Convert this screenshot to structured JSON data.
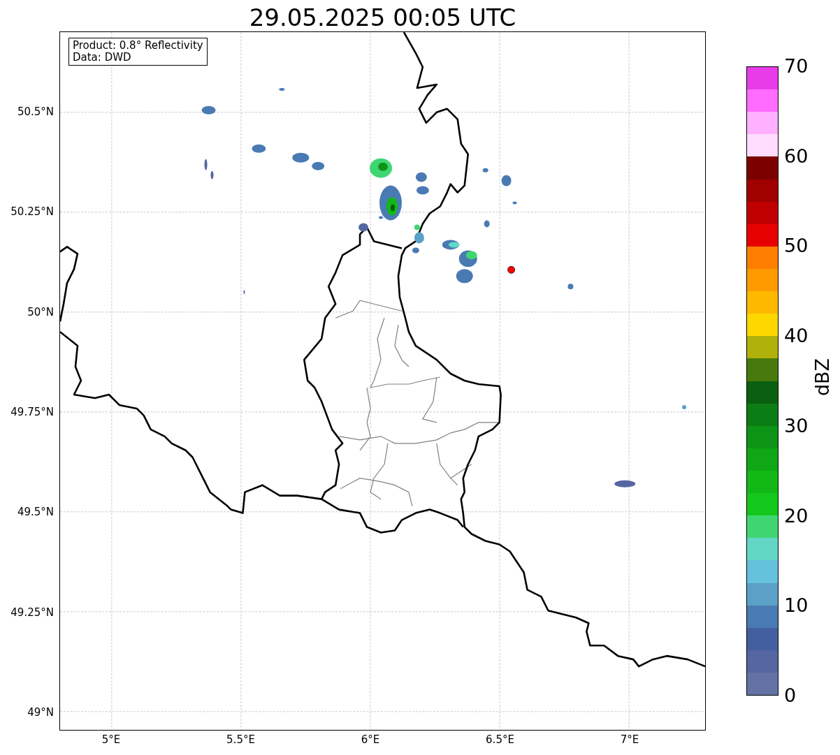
{
  "title": "29.05.2025 00:05 UTC",
  "legend": [
    "Product: 0.8° Reflectivity",
    "Data: DWD"
  ],
  "y_ticks": [
    "50.5°N",
    "50.25°N",
    "50°N",
    "49.75°N",
    "49.5°N",
    "49.25°N",
    "49°N"
  ],
  "x_ticks": [
    "5°E",
    "5.5°E",
    "6°E",
    "6.5°E",
    "7°E"
  ],
  "colorbar": {
    "label": "dBZ",
    "ticks": [
      "70",
      "60",
      "50",
      "40",
      "30",
      "20",
      "10",
      "0"
    ],
    "segments": [
      {
        "color": "#e83ce9"
      },
      {
        "color": "#ff6cff"
      },
      {
        "color": "#ffb0ff"
      },
      {
        "color": "#ffdcff"
      },
      {
        "color": "#7b0000"
      },
      {
        "color": "#a00000"
      },
      {
        "color": "#c00000"
      },
      {
        "color": "#e60000"
      },
      {
        "color": "#ff7f00"
      },
      {
        "color": "#ff9a00"
      },
      {
        "color": "#ffb800"
      },
      {
        "color": "#ffd700"
      },
      {
        "color": "#b0b10a"
      },
      {
        "color": "#477a0c"
      },
      {
        "color": "#095f0f"
      },
      {
        "color": "#0b7d14"
      },
      {
        "color": "#0d9316"
      },
      {
        "color": "#0fa716"
      },
      {
        "color": "#12b916"
      },
      {
        "color": "#14c81b"
      },
      {
        "color": "#3fd671"
      },
      {
        "color": "#63d7c6"
      },
      {
        "color": "#66c2dc"
      },
      {
        "color": "#5ba0c6"
      },
      {
        "color": "#4a7ab3"
      },
      {
        "color": "#435fa0"
      },
      {
        "color": "#5566a0"
      },
      {
        "color": "#6373a6"
      }
    ]
  }
}
